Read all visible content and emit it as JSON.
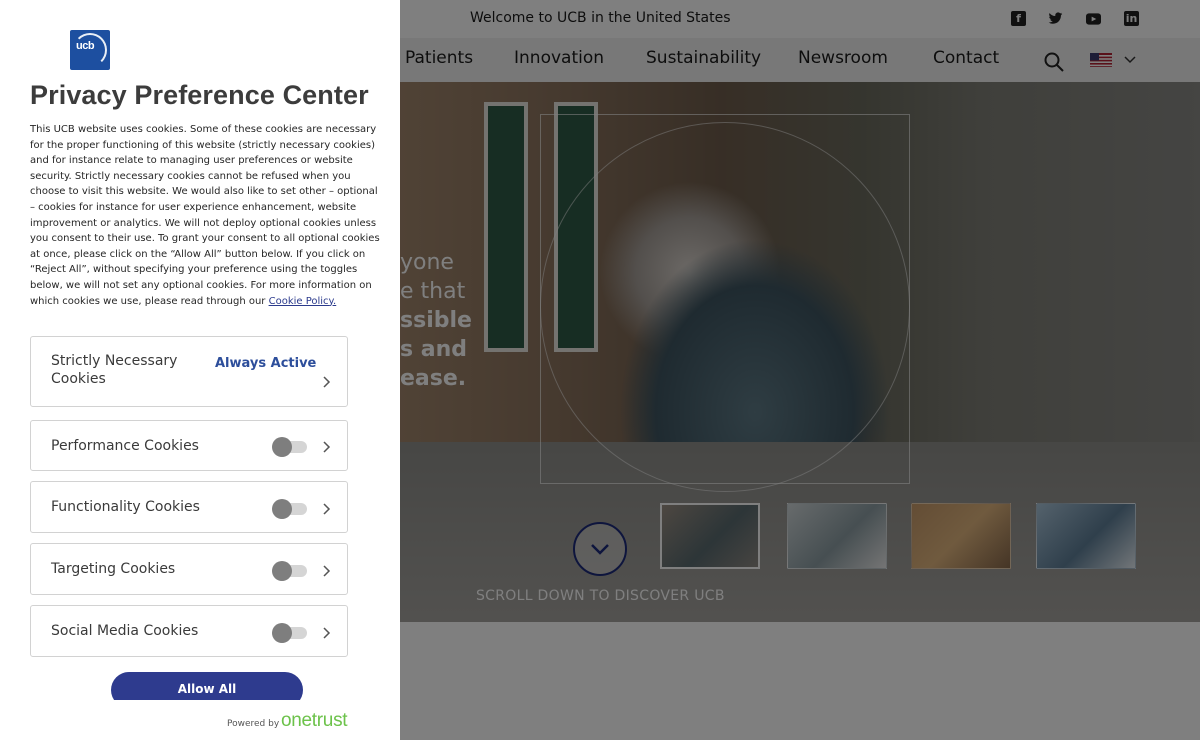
{
  "site": {
    "welcome": "Welcome to UCB in the United States",
    "social_icons": [
      "facebook-icon",
      "twitter-icon",
      "youtube-icon",
      "linkedin-icon"
    ],
    "nav": [
      "Patients",
      "Innovation",
      "Sustainability",
      "Newsroom",
      "Contact"
    ],
    "hero_text_lines": [
      "yone",
      "e that",
      "ssible",
      "s and",
      "ease."
    ],
    "scroll_text": "SCROLL DOWN TO DISCOVER UCB",
    "thumbnail_count": 4
  },
  "panel": {
    "logo_text": "ucb",
    "title": "Privacy Preference Center",
    "description": "This UCB website uses cookies. Some of these cookies are necessary for the proper functioning of this website (strictly necessary cookies) and for instance relate to managing user preferences or website security. Strictly necessary cookies cannot be refused when you choose to visit this website. We would also like to set other – optional – cookies for instance for user experience enhancement, website improvement or analytics. We will not deploy optional cookies unless you consent to their use. To grant your consent to all optional cookies at once, please click on the “Allow All” button below. If you click on “Reject All”, without specifying your preference using the toggles below, we will not set any optional cookies. For more information on which cookies we use, please read through our",
    "cookie_policy_link": "Cookie Policy.",
    "categories": [
      {
        "label": "Strictly Necessary Cookies",
        "status": "Always Active"
      },
      {
        "label": "Performance Cookies",
        "enabled": false
      },
      {
        "label": "Functionality Cookies",
        "enabled": false
      },
      {
        "label": "Targeting Cookies",
        "enabled": false
      },
      {
        "label": "Social Media Cookies",
        "enabled": false
      }
    ],
    "allow_all": "Allow All",
    "powered_by": "Powered by",
    "brand": "Onetrust"
  },
  "colors": {
    "accent": "#2e3b8e",
    "always_active": "#2d4e9b",
    "onetrust_green": "#6cc24a"
  }
}
